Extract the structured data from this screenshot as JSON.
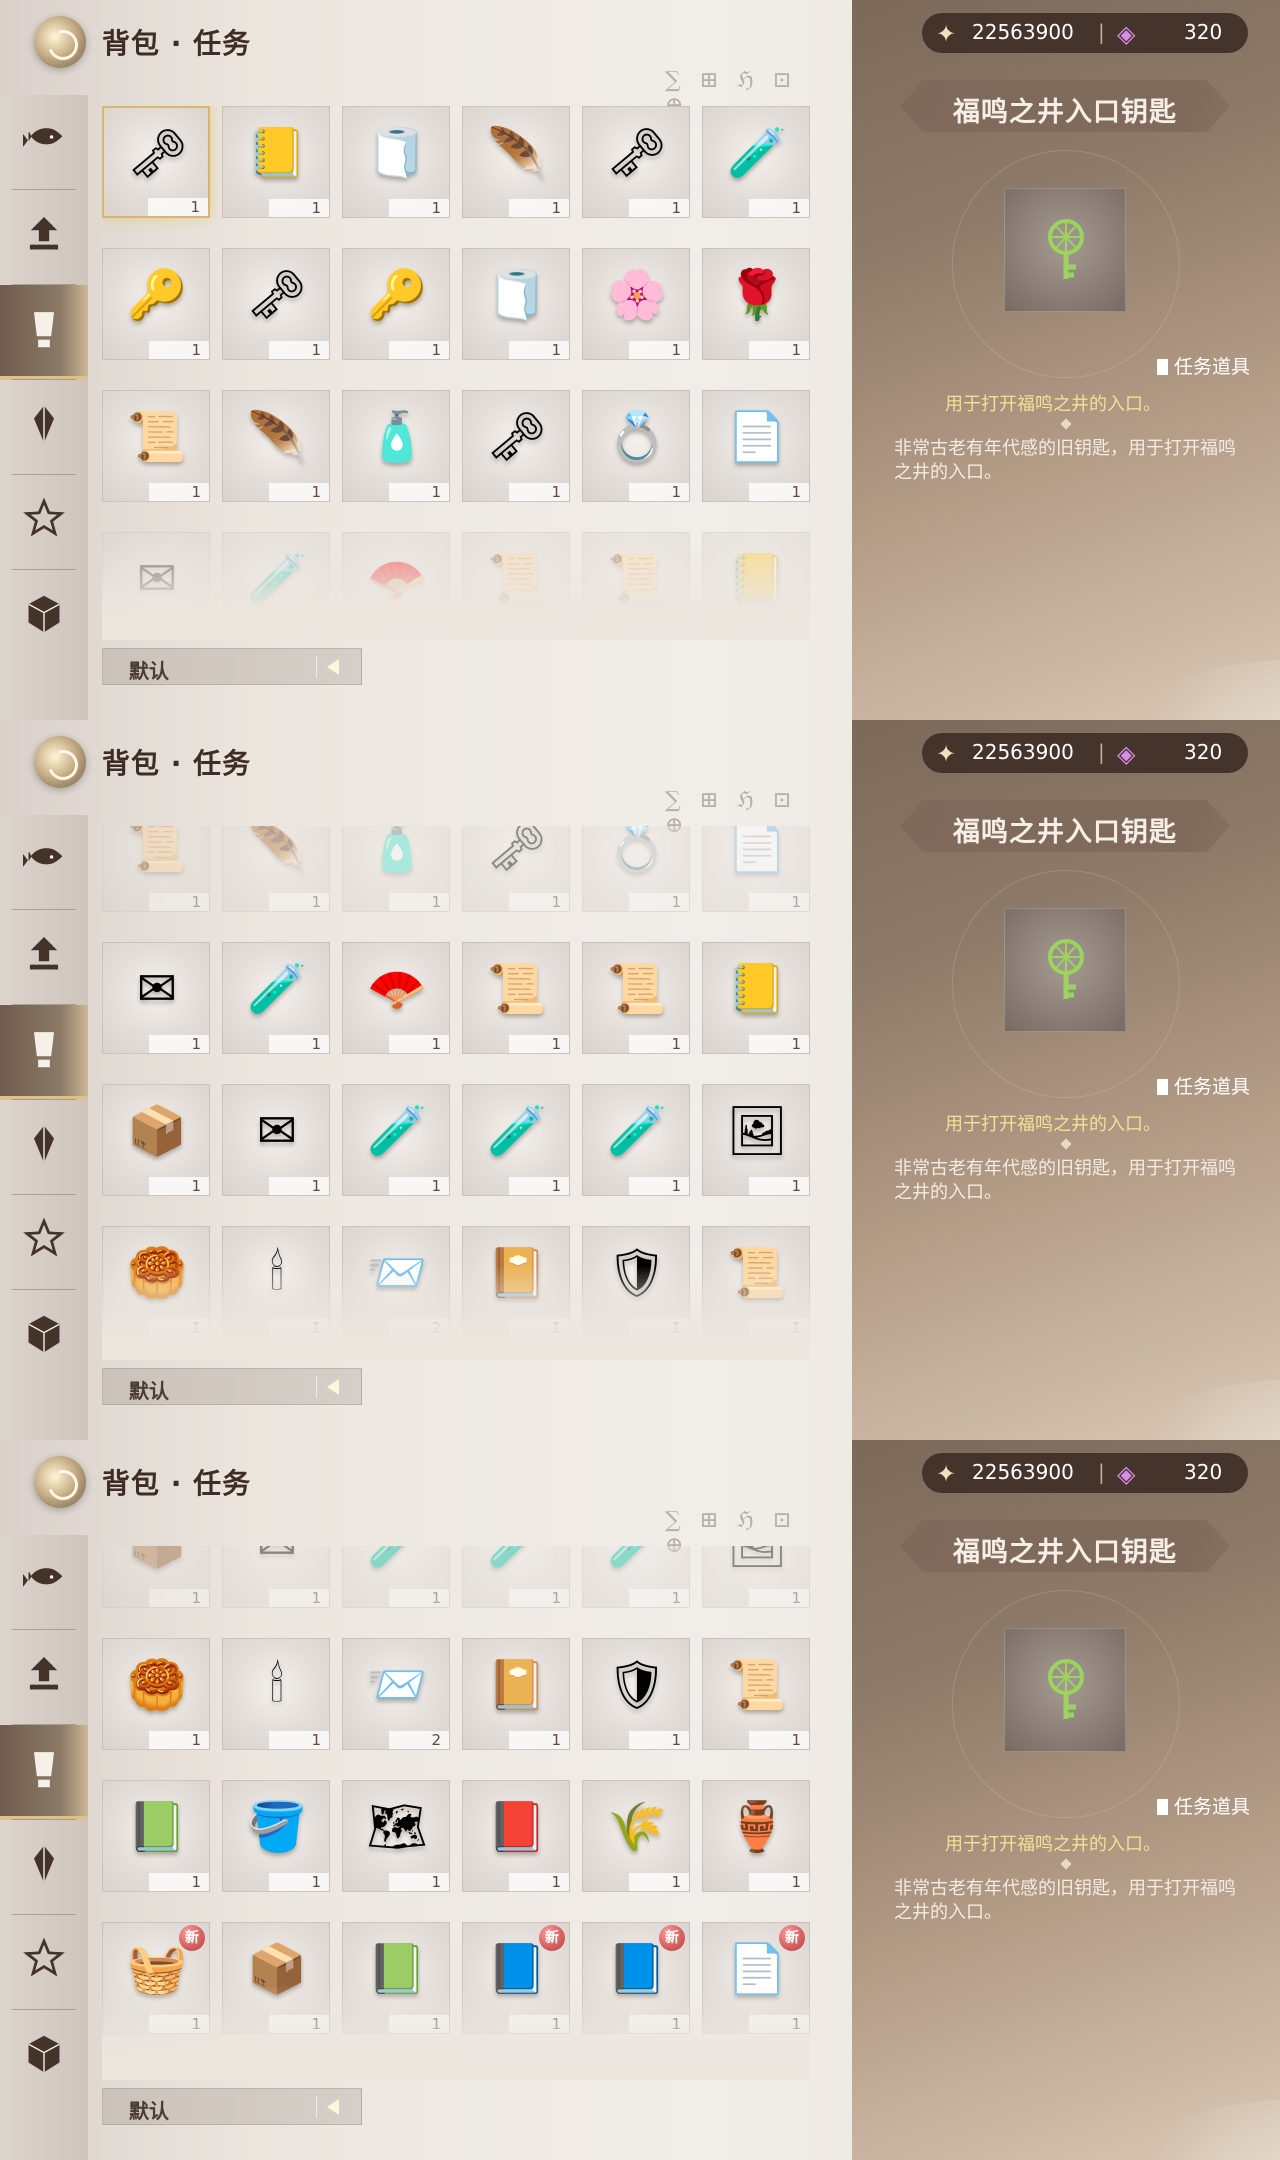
{
  "header": {
    "title": "背包 · 任务",
    "decorative_text": "∑ ⊞ ℌ ⊡ ⊕"
  },
  "currency": {
    "star_value": "22563900",
    "separator": "|",
    "gem_value": "320"
  },
  "detail": {
    "name": "福鸣之井入口钥匙",
    "type": "任务道具",
    "usage": "用于打开福鸣之井的入口。",
    "description": "非常古老有年代感的旧钥匙，用于打开福鸣之井的入口。"
  },
  "sort": {
    "label": "默认"
  },
  "rail_icons": [
    "fish-icon",
    "arrow-up-icon",
    "exclamation-icon",
    "crystal-icon",
    "star-icon",
    "box-icon"
  ],
  "screens": [
    {
      "offset_index": 0,
      "items": [
        {
          "emoji": "🗝",
          "qty": "1",
          "selected": true,
          "dim": false,
          "new": false
        },
        {
          "emoji": "📒",
          "qty": "1",
          "selected": false,
          "dim": false,
          "new": false
        },
        {
          "emoji": "🧻",
          "qty": "1",
          "selected": false,
          "dim": false,
          "new": false
        },
        {
          "emoji": "🪶",
          "qty": "1",
          "selected": false,
          "dim": false,
          "new": false
        },
        {
          "emoji": "🗝",
          "qty": "1",
          "selected": false,
          "dim": false,
          "new": false
        },
        {
          "emoji": "🧪",
          "qty": "1",
          "selected": false,
          "dim": false,
          "new": false
        },
        {
          "emoji": "🔑",
          "qty": "1",
          "selected": false,
          "dim": false,
          "new": false
        },
        {
          "emoji": "🗝",
          "qty": "1",
          "selected": false,
          "dim": false,
          "new": false
        },
        {
          "emoji": "🔑",
          "qty": "1",
          "selected": false,
          "dim": false,
          "new": false
        },
        {
          "emoji": "🧻",
          "qty": "1",
          "selected": false,
          "dim": false,
          "new": false
        },
        {
          "emoji": "🌸",
          "qty": "1",
          "selected": false,
          "dim": false,
          "new": false
        },
        {
          "emoji": "🌹",
          "qty": "1",
          "selected": false,
          "dim": false,
          "new": false
        },
        {
          "emoji": "📜",
          "qty": "1",
          "selected": false,
          "dim": false,
          "new": false
        },
        {
          "emoji": "🪶",
          "qty": "1",
          "selected": false,
          "dim": false,
          "new": false
        },
        {
          "emoji": "🧴",
          "qty": "1",
          "selected": false,
          "dim": false,
          "new": false
        },
        {
          "emoji": "🗝",
          "qty": "1",
          "selected": false,
          "dim": false,
          "new": false
        },
        {
          "emoji": "💍",
          "qty": "1",
          "selected": false,
          "dim": false,
          "new": false
        },
        {
          "emoji": "📄",
          "qty": "1",
          "selected": false,
          "dim": false,
          "new": false
        },
        {
          "emoji": "✉",
          "qty": "1",
          "selected": false,
          "dim": true,
          "new": false
        },
        {
          "emoji": "🧪",
          "qty": "1",
          "selected": false,
          "dim": true,
          "new": false
        },
        {
          "emoji": "🪭",
          "qty": "1",
          "selected": false,
          "dim": true,
          "new": false
        },
        {
          "emoji": "📜",
          "qty": "1",
          "selected": false,
          "dim": true,
          "new": false
        },
        {
          "emoji": "📜",
          "qty": "1",
          "selected": false,
          "dim": true,
          "new": false
        },
        {
          "emoji": "📒",
          "qty": "1",
          "selected": false,
          "dim": true,
          "new": false
        }
      ]
    },
    {
      "offset_index": 1,
      "items": [
        {
          "emoji": "📜",
          "qty": "1",
          "selected": false,
          "dim": true,
          "new": false
        },
        {
          "emoji": "🪶",
          "qty": "1",
          "selected": false,
          "dim": true,
          "new": false
        },
        {
          "emoji": "🧴",
          "qty": "1",
          "selected": false,
          "dim": true,
          "new": false
        },
        {
          "emoji": "🗝",
          "qty": "1",
          "selected": false,
          "dim": true,
          "new": false
        },
        {
          "emoji": "💍",
          "qty": "1",
          "selected": false,
          "dim": true,
          "new": false
        },
        {
          "emoji": "📄",
          "qty": "1",
          "selected": false,
          "dim": true,
          "new": false
        },
        {
          "emoji": "✉",
          "qty": "1",
          "selected": false,
          "dim": false,
          "new": false
        },
        {
          "emoji": "🧪",
          "qty": "1",
          "selected": false,
          "dim": false,
          "new": false
        },
        {
          "emoji": "🪭",
          "qty": "1",
          "selected": false,
          "dim": false,
          "new": false
        },
        {
          "emoji": "📜",
          "qty": "1",
          "selected": false,
          "dim": false,
          "new": false
        },
        {
          "emoji": "📜",
          "qty": "1",
          "selected": false,
          "dim": false,
          "new": false
        },
        {
          "emoji": "📒",
          "qty": "1",
          "selected": false,
          "dim": false,
          "new": false
        },
        {
          "emoji": "📦",
          "qty": "1",
          "selected": false,
          "dim": false,
          "new": false
        },
        {
          "emoji": "✉",
          "qty": "1",
          "selected": false,
          "dim": false,
          "new": false
        },
        {
          "emoji": "🧪",
          "qty": "1",
          "selected": false,
          "dim": false,
          "new": false
        },
        {
          "emoji": "🧪",
          "qty": "1",
          "selected": false,
          "dim": false,
          "new": false
        },
        {
          "emoji": "🧪",
          "qty": "1",
          "selected": false,
          "dim": false,
          "new": false
        },
        {
          "emoji": "🖼",
          "qty": "1",
          "selected": false,
          "dim": false,
          "new": false
        },
        {
          "emoji": "🥮",
          "qty": "1",
          "selected": false,
          "dim": false,
          "new": false
        },
        {
          "emoji": "🕯",
          "qty": "1",
          "selected": false,
          "dim": false,
          "new": false
        },
        {
          "emoji": "📨",
          "qty": "2",
          "selected": false,
          "dim": false,
          "new": false
        },
        {
          "emoji": "📔",
          "qty": "1",
          "selected": false,
          "dim": false,
          "new": false
        },
        {
          "emoji": "🛡",
          "qty": "1",
          "selected": false,
          "dim": false,
          "new": false
        },
        {
          "emoji": "📜",
          "qty": "1",
          "selected": false,
          "dim": false,
          "new": false
        }
      ]
    },
    {
      "offset_index": 2,
      "items": [
        {
          "emoji": "📦",
          "qty": "1",
          "selected": false,
          "dim": true,
          "new": false
        },
        {
          "emoji": "✉",
          "qty": "1",
          "selected": false,
          "dim": true,
          "new": false
        },
        {
          "emoji": "🧪",
          "qty": "1",
          "selected": false,
          "dim": true,
          "new": false
        },
        {
          "emoji": "🧪",
          "qty": "1",
          "selected": false,
          "dim": true,
          "new": false
        },
        {
          "emoji": "🧪",
          "qty": "1",
          "selected": false,
          "dim": true,
          "new": false
        },
        {
          "emoji": "🖼",
          "qty": "1",
          "selected": false,
          "dim": true,
          "new": false
        },
        {
          "emoji": "🥮",
          "qty": "1",
          "selected": false,
          "dim": false,
          "new": false
        },
        {
          "emoji": "🕯",
          "qty": "1",
          "selected": false,
          "dim": false,
          "new": false
        },
        {
          "emoji": "📨",
          "qty": "2",
          "selected": false,
          "dim": false,
          "new": false
        },
        {
          "emoji": "📔",
          "qty": "1",
          "selected": false,
          "dim": false,
          "new": false
        },
        {
          "emoji": "🛡",
          "qty": "1",
          "selected": false,
          "dim": false,
          "new": false
        },
        {
          "emoji": "📜",
          "qty": "1",
          "selected": false,
          "dim": false,
          "new": false
        },
        {
          "emoji": "📗",
          "qty": "1",
          "selected": false,
          "dim": false,
          "new": false
        },
        {
          "emoji": "🪣",
          "qty": "1",
          "selected": false,
          "dim": false,
          "new": false
        },
        {
          "emoji": "🗺",
          "qty": "1",
          "selected": false,
          "dim": false,
          "new": false
        },
        {
          "emoji": "📕",
          "qty": "1",
          "selected": false,
          "dim": false,
          "new": false
        },
        {
          "emoji": "🌾",
          "qty": "1",
          "selected": false,
          "dim": false,
          "new": false
        },
        {
          "emoji": "🏺",
          "qty": "1",
          "selected": false,
          "dim": false,
          "new": false
        },
        {
          "emoji": "🧺",
          "qty": "1",
          "selected": false,
          "dim": false,
          "new": true
        },
        {
          "emoji": "📦",
          "qty": "1",
          "selected": false,
          "dim": false,
          "new": false
        },
        {
          "emoji": "📗",
          "qty": "1",
          "selected": false,
          "dim": false,
          "new": false
        },
        {
          "emoji": "📘",
          "qty": "1",
          "selected": false,
          "dim": false,
          "new": true
        },
        {
          "emoji": "📘",
          "qty": "1",
          "selected": false,
          "dim": false,
          "new": true
        },
        {
          "emoji": "📄",
          "qty": "1",
          "selected": false,
          "dim": false,
          "new": true
        }
      ]
    }
  ],
  "new_badge_label": "新"
}
